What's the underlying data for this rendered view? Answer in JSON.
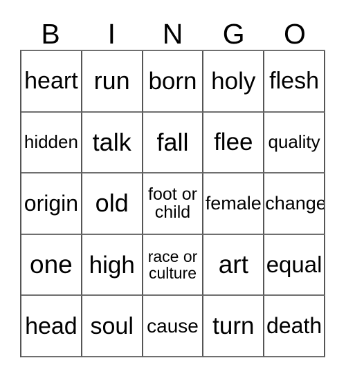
{
  "card": {
    "header_letters": [
      "B",
      "I",
      "N",
      "G",
      "O"
    ],
    "background_color": "#ffffff",
    "text_color": "#000000",
    "grid_line_color": "#555555",
    "rows": 5,
    "columns": 5,
    "grid": [
      [
        {
          "text": "heart",
          "font_size": 34
        },
        {
          "text": "run",
          "font_size": 36
        },
        {
          "text": "born",
          "font_size": 35
        },
        {
          "text": "holy",
          "font_size": 35
        },
        {
          "text": "flesh",
          "font_size": 34
        }
      ],
      [
        {
          "text": "hidden",
          "font_size": 26
        },
        {
          "text": "talk",
          "font_size": 36
        },
        {
          "text": "fall",
          "font_size": 36
        },
        {
          "text": "flee",
          "font_size": 35
        },
        {
          "text": "quality",
          "font_size": 26
        }
      ],
      [
        {
          "text": "origin",
          "font_size": 32
        },
        {
          "text": "old",
          "font_size": 36
        },
        {
          "text": "foot or child",
          "font_size": 25
        },
        {
          "text": "female",
          "font_size": 27
        },
        {
          "text": "change",
          "font_size": 27
        }
      ],
      [
        {
          "text": "one",
          "font_size": 37
        },
        {
          "text": "high",
          "font_size": 35
        },
        {
          "text": "race or culture",
          "font_size": 23
        },
        {
          "text": "art",
          "font_size": 37
        },
        {
          "text": "equal",
          "font_size": 33
        }
      ],
      [
        {
          "text": "head",
          "font_size": 34
        },
        {
          "text": "soul",
          "font_size": 34
        },
        {
          "text": "cause",
          "font_size": 28
        },
        {
          "text": "turn",
          "font_size": 35
        },
        {
          "text": "death",
          "font_size": 32
        }
      ]
    ]
  }
}
